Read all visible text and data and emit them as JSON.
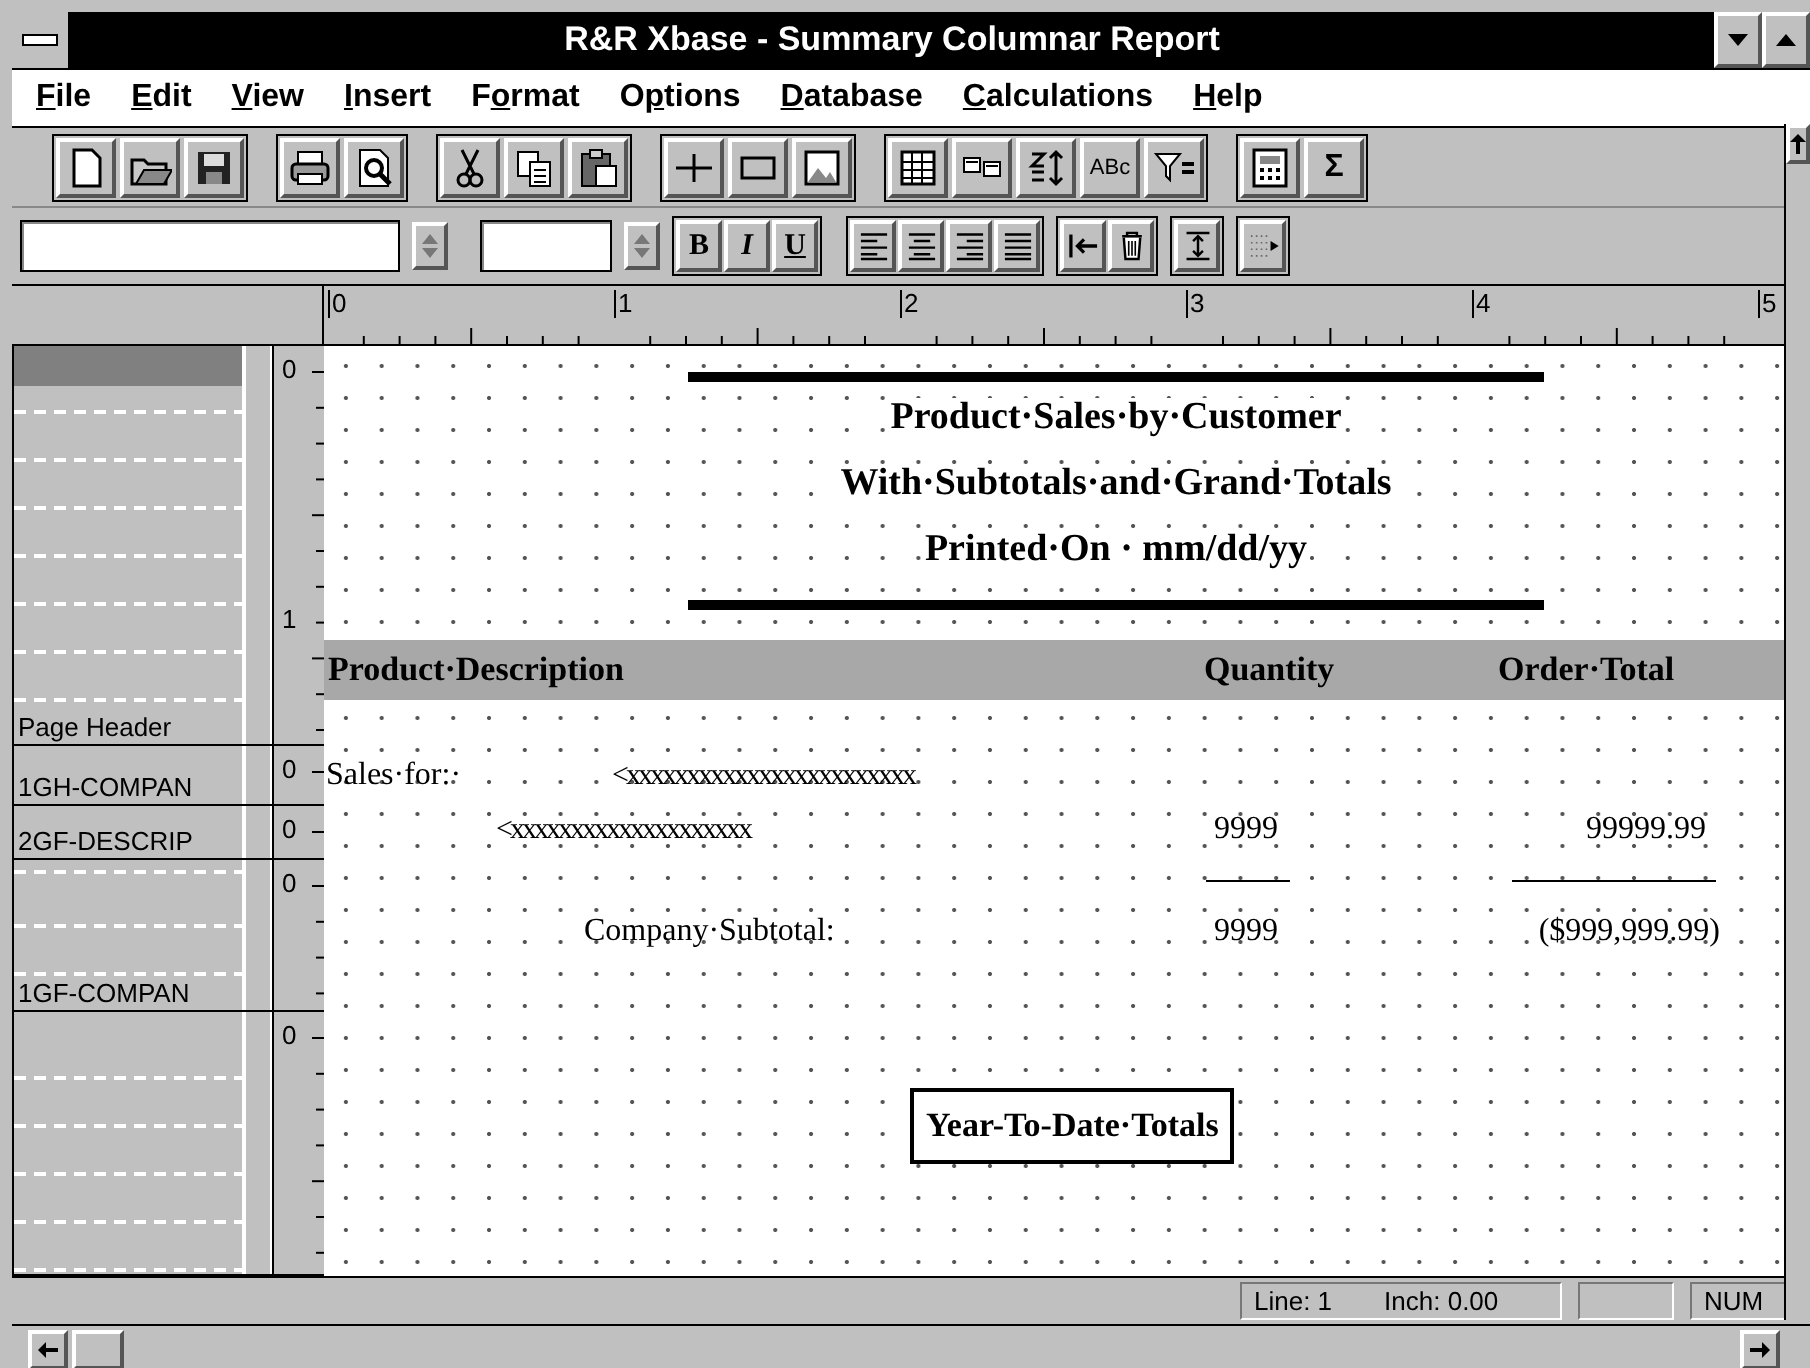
{
  "window": {
    "title": "R&R Xbase - Summary Columnar Report"
  },
  "menu": [
    {
      "accel": "F",
      "rest": "ile"
    },
    {
      "accel": "E",
      "rest": "dit"
    },
    {
      "accel": "V",
      "rest": "iew"
    },
    {
      "accel": "I",
      "rest": "nsert"
    },
    {
      "lead": "F",
      "accel": "o",
      "rest": "rmat"
    },
    {
      "lead": "O",
      "accel": "p",
      "rest": "tions"
    },
    {
      "accel": "D",
      "rest": "atabase"
    },
    {
      "accel": "C",
      "rest": "alculations"
    },
    {
      "accel": "H",
      "rest": "elp"
    }
  ],
  "toolbar": [
    [
      {
        "kind": "new"
      },
      {
        "kind": "open"
      },
      {
        "kind": "save"
      }
    ],
    [
      {
        "kind": "print"
      },
      {
        "kind": "preview"
      }
    ],
    [
      {
        "kind": "cut"
      },
      {
        "kind": "copy"
      },
      {
        "kind": "paste"
      }
    ],
    [
      {
        "kind": "line"
      },
      {
        "kind": "box"
      },
      {
        "kind": "image"
      }
    ],
    [
      {
        "kind": "table"
      },
      {
        "kind": "fields"
      },
      {
        "kind": "sort"
      },
      {
        "kind": "text",
        "label": "ABc"
      },
      {
        "kind": "filter"
      }
    ],
    [
      {
        "kind": "calc"
      },
      {
        "kind": "sum",
        "label": "Σ"
      }
    ]
  ],
  "format_toolbar": {
    "style_buttons": [
      {
        "kind": "bold",
        "label": "B"
      },
      {
        "kind": "italic",
        "label": "I"
      },
      {
        "kind": "underline",
        "label": "U"
      }
    ],
    "align_buttons": [
      {
        "kind": "left"
      },
      {
        "kind": "center"
      },
      {
        "kind": "right"
      },
      {
        "kind": "justify"
      }
    ],
    "tool_buttons": [
      {
        "kind": "indent"
      },
      {
        "kind": "delete"
      },
      {
        "kind": "spacing"
      },
      {
        "kind": "insert"
      }
    ]
  },
  "ruler": {
    "marks": [
      "0",
      "1",
      "2",
      "3",
      "4",
      "5"
    ]
  },
  "bands": [
    {
      "label": "Page Header",
      "highlighted": true,
      "marks": [
        "0",
        "1"
      ]
    },
    {
      "label": "1GH-COMPAN",
      "highlighted": false,
      "marks": [
        "0"
      ]
    },
    {
      "label": "2GF-DESCRIP",
      "highlighted": false,
      "marks": [
        "0"
      ]
    },
    {
      "label": "1GF-COMPAN",
      "highlighted": false,
      "marks": [
        "0"
      ]
    },
    {
      "highlighted": false,
      "marks": [
        "0"
      ]
    }
  ],
  "report": {
    "title_lines": [
      "Product·Sales·by·Customer",
      "With·Subtotals·and·Grand·Totals",
      "Printed·On · mm/dd/yy"
    ],
    "column_headings": [
      "Product·Description",
      "Quantity",
      "Order·Total"
    ],
    "group_header": {
      "label": "Sales·for:·",
      "field": "<xxxxxxxxxxxxxxxxxxxxxxxx"
    },
    "detail": {
      "field": "<xxxxxxxxxxxxxxxxxxxx",
      "quantity": "9999",
      "total": "99999.99"
    },
    "subtotal": {
      "label": "Company·Subtotal:",
      "quantity": "9999",
      "total": "($999,999.99)"
    },
    "summary_title": "Year-To-Date·Totals"
  },
  "status_bar": {
    "line": "Line: 1",
    "inch": "Inch: 0.00",
    "mode": "NUM"
  }
}
